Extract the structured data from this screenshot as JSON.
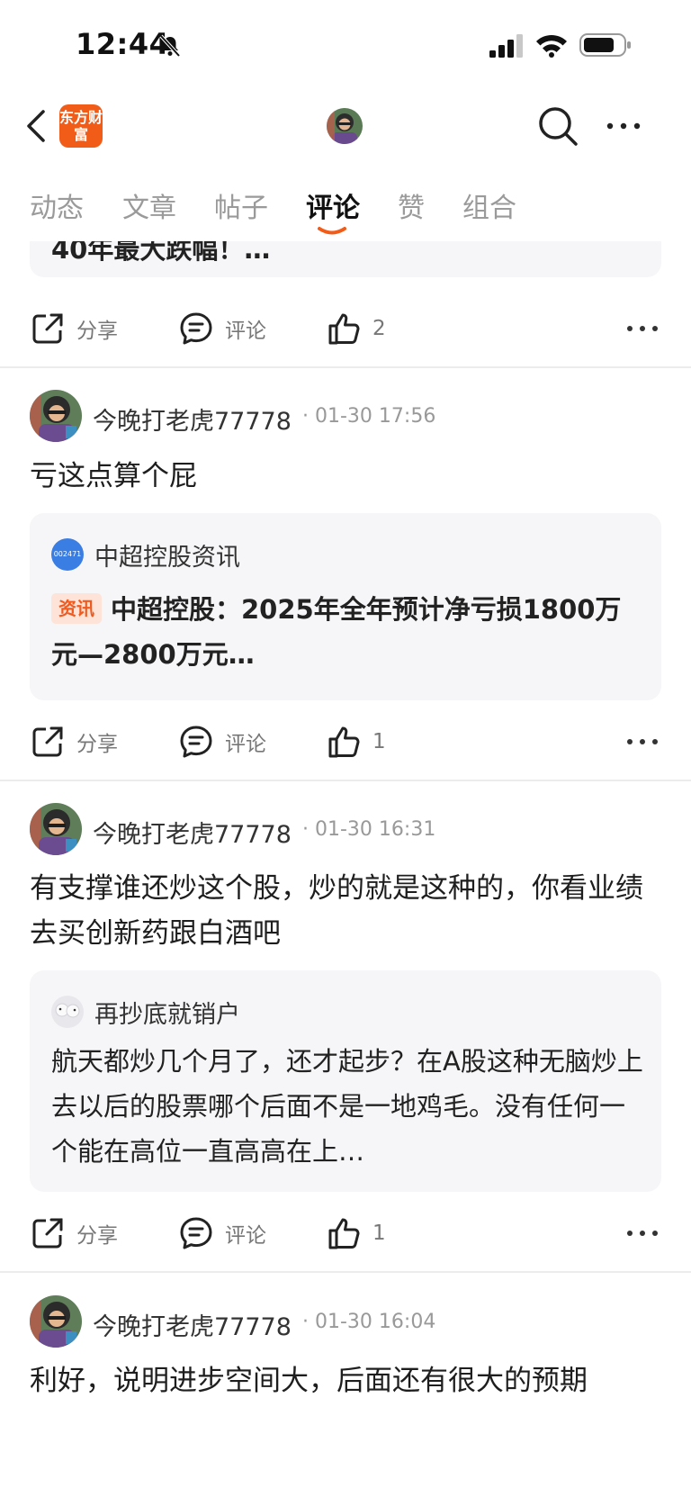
{
  "status_bar": {
    "time": "12:44"
  },
  "nav": {
    "logo_text": "东方财富"
  },
  "tabs": [
    {
      "label": "动态",
      "active": false
    },
    {
      "label": "文章",
      "active": false
    },
    {
      "label": "帖子",
      "active": false
    },
    {
      "label": "评论",
      "active": true
    },
    {
      "label": "赞",
      "active": false
    },
    {
      "label": "组合",
      "active": false
    }
  ],
  "actions": {
    "share": "分享",
    "comment": "评论"
  },
  "colors": {
    "accent": "#f25c19",
    "tab_underline": "#f25c19",
    "stock_badge": "#3b7ee3"
  },
  "partial_post": {
    "quote_tail": "40年最大跌幅！…",
    "likes": "2"
  },
  "posts": [
    {
      "author": "今晚打老虎77778",
      "time": "01-30 17:56",
      "text": "亏这点算个屁",
      "quote": {
        "source_badge": "002471",
        "source": "中超控股资讯",
        "tag": "资讯",
        "text": "中超控股：2025年全年预计净亏损1800万元—2800万元…"
      },
      "likes": "1"
    },
    {
      "author": "今晚打老虎77778",
      "time": "01-30 16:31",
      "text": "有支撑谁还炒这个股，炒的就是这种的，你看业绩去买创新药跟白酒吧",
      "quote": {
        "source": "再抄底就销户",
        "text": "航天都炒几个月了，还才起步？在A股这种无脑炒上去以后的股票哪个后面不是一地鸡毛。没有任何一个能在高位一直高高在上…"
      },
      "likes": "1"
    },
    {
      "author": "今晚打老虎77778",
      "time": "01-30 16:04",
      "text": "利好，说明进步空间大，后面还有很大的预期"
    }
  ]
}
